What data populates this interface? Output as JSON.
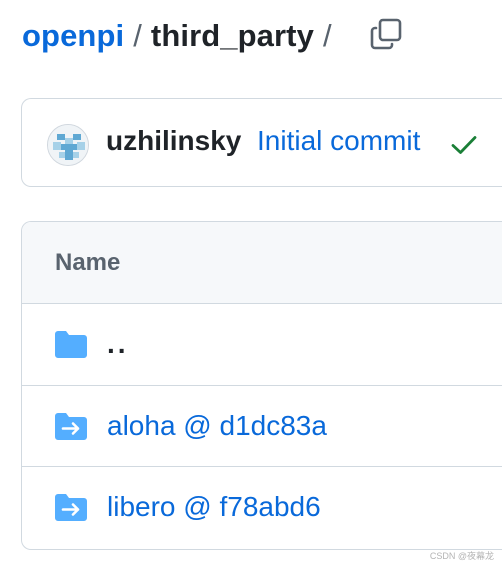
{
  "breadcrumb": {
    "repo": "openpi",
    "separator": "/",
    "current": "third_party",
    "trailing_separator": "/"
  },
  "toolbar": {
    "copy_icon": "copy-icon"
  },
  "commit": {
    "avatar_icon": "identicon-avatar",
    "author": "uzhilinsky",
    "message": "Initial commit",
    "status_icon": "check-icon",
    "status_color": "#1a7f37"
  },
  "table": {
    "header_name": "Name",
    "rows": [
      {
        "label": "..",
        "icon": "folder-icon",
        "type": "parent-directory"
      },
      {
        "label": "aloha @ d1dc83a",
        "icon": "submodule-folder-icon",
        "type": "submodule"
      },
      {
        "label": "libero @ f78abd6",
        "icon": "submodule-folder-icon",
        "type": "submodule"
      }
    ]
  },
  "colors": {
    "link": "#0969da",
    "folder": "#54aeff",
    "border": "#d1d9e0",
    "header_bg": "#f6f8fa",
    "muted_text": "#59636e"
  },
  "watermark": "CSDN @夜幕龙"
}
